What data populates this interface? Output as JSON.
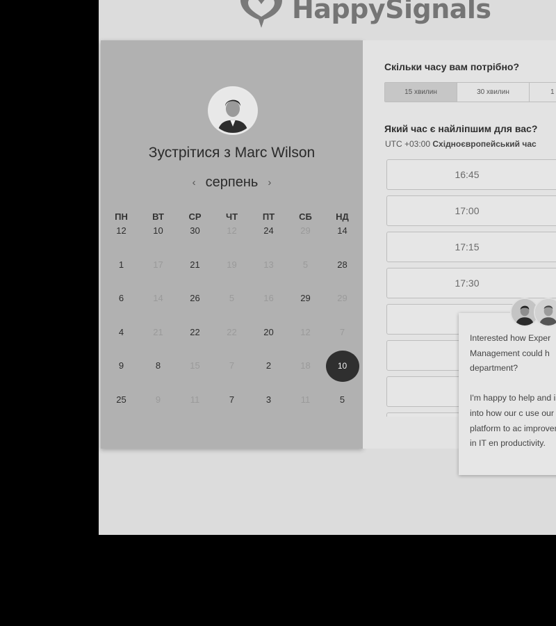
{
  "brand": {
    "name": "HappySignals"
  },
  "calendar": {
    "title": "Зустрітися з Marc Wilson",
    "month": "серпень",
    "prev_arrow": "‹",
    "next_arrow": "›",
    "weekdays": [
      "ПН",
      "ВТ",
      "СР",
      "ЧТ",
      "ПТ",
      "СБ",
      "НД"
    ],
    "days": [
      {
        "label": "12",
        "muted": false
      },
      {
        "label": "10",
        "muted": false
      },
      {
        "label": "30",
        "muted": false
      },
      {
        "label": "12",
        "muted": true
      },
      {
        "label": "24",
        "muted": false
      },
      {
        "label": "29",
        "muted": true
      },
      {
        "label": "14",
        "muted": false
      },
      {
        "label": "1",
        "muted": false
      },
      {
        "label": "17",
        "muted": true
      },
      {
        "label": "21",
        "muted": false
      },
      {
        "label": "19",
        "muted": true
      },
      {
        "label": "13",
        "muted": true
      },
      {
        "label": "5",
        "muted": true
      },
      {
        "label": "28",
        "muted": false
      },
      {
        "label": "6",
        "muted": false
      },
      {
        "label": "14",
        "muted": true
      },
      {
        "label": "26",
        "muted": false
      },
      {
        "label": "5",
        "muted": true
      },
      {
        "label": "16",
        "muted": true
      },
      {
        "label": "29",
        "muted": false
      },
      {
        "label": "29",
        "muted": true
      },
      {
        "label": "4",
        "muted": false
      },
      {
        "label": "21",
        "muted": true
      },
      {
        "label": "22",
        "muted": false
      },
      {
        "label": "22",
        "muted": true
      },
      {
        "label": "20",
        "muted": false
      },
      {
        "label": "12",
        "muted": true
      },
      {
        "label": "7",
        "muted": true
      },
      {
        "label": "9",
        "muted": false
      },
      {
        "label": "8",
        "muted": false
      },
      {
        "label": "15",
        "muted": true
      },
      {
        "label": "7",
        "muted": true
      },
      {
        "label": "2",
        "muted": false
      },
      {
        "label": "18",
        "muted": true
      },
      {
        "label": "10",
        "muted": false,
        "selected": true
      },
      {
        "label": "25",
        "muted": false
      },
      {
        "label": "9",
        "muted": true
      },
      {
        "label": "11",
        "muted": true
      },
      {
        "label": "7",
        "muted": false
      },
      {
        "label": "3",
        "muted": false
      },
      {
        "label": "11",
        "muted": true
      },
      {
        "label": "5",
        "muted": false
      }
    ]
  },
  "booking": {
    "duration_question": "Скільки часу вам потрібно?",
    "durations": [
      "15 хвилин",
      "30 хвилин",
      "1"
    ],
    "active_duration": "15 хвилин",
    "time_question": "Який час є найліпшим для вас?",
    "timezone_offset": "UTC +03:00",
    "timezone_name": "Східноєвропейський час",
    "slots": [
      "16:45",
      "17:00",
      "17:15",
      "17:30",
      "",
      "",
      "",
      ""
    ]
  },
  "chat": {
    "paragraph1": "Interested how Exper Management could h department?",
    "paragraph2": "I'm happy to help and insight into how our c use our platform to ac improvement in IT en productivity."
  }
}
